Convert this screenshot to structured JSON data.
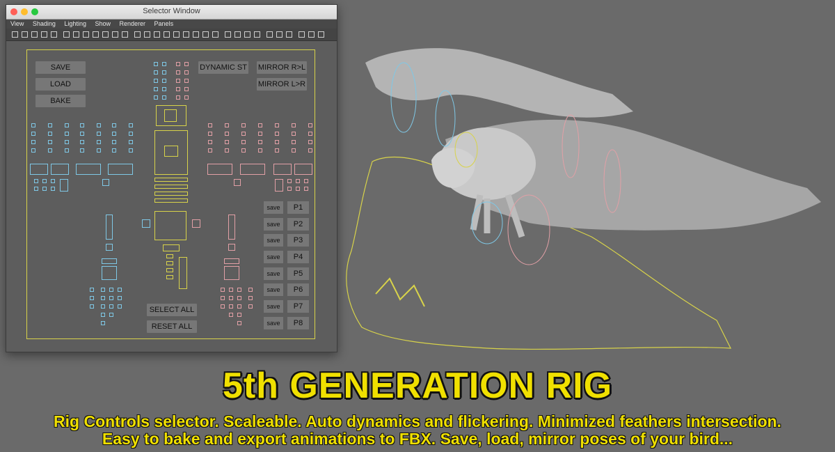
{
  "window": {
    "title": "Selector Window",
    "menu": [
      "View",
      "Shading",
      "Lighting",
      "Show",
      "Renderer",
      "Panels"
    ]
  },
  "selector": {
    "save_label": "SAVE",
    "load_label": "LOAD",
    "bake_label": "BAKE",
    "dynamic_label": "DYNAMIC ST",
    "mirror_rl_label": "MIRROR R>L",
    "mirror_lr_label": "MIRROR L>R",
    "select_all_label": "SELECT ALL",
    "reset_all_label": "RESET ALL",
    "pose_save_label": "save",
    "poses": [
      "P1",
      "P2",
      "P3",
      "P4",
      "P5",
      "P6",
      "P7",
      "P8"
    ]
  },
  "colors": {
    "left_controls": "#7fc8e6",
    "right_controls": "#e2a0a6",
    "center_controls": "#d8d34a",
    "headline": "#f0e000"
  },
  "headline": "5th GENERATION RIG",
  "subtitle_line1": "Rig Controls selector. Scaleable. Auto dynamics and flickering. Minimized feathers intersection.",
  "subtitle_line2": "Easy to bake and export animations to FBX. Save, load, mirror poses of your bird..."
}
